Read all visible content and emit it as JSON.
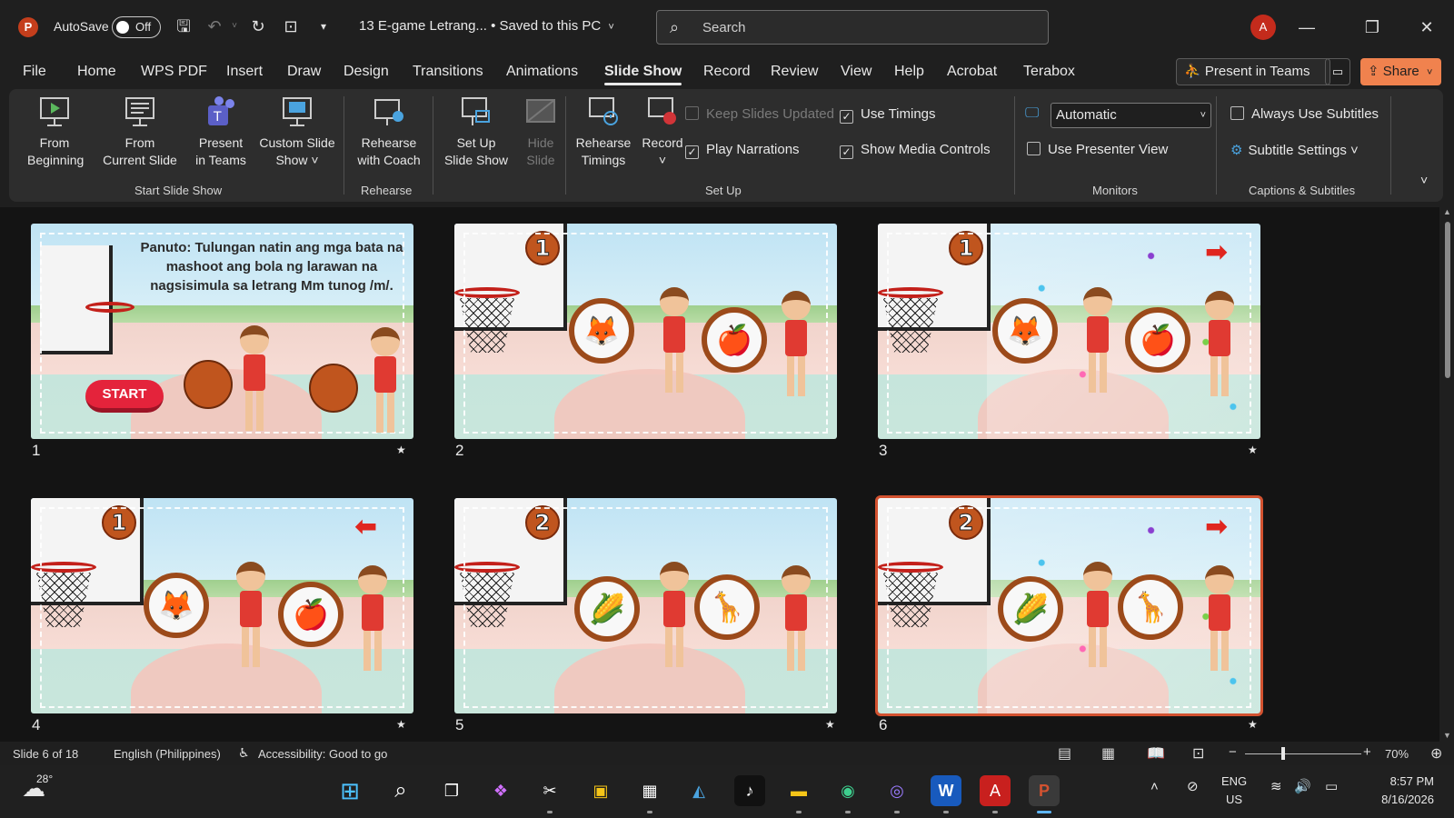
{
  "titlebar": {
    "autosave_label": "AutoSave",
    "autosave_state": "Off",
    "document_title": "13 E-game Letrang...  •  Saved to this PC",
    "search_placeholder": "Search",
    "avatar_initial": "A"
  },
  "menu": {
    "tabs": [
      "File",
      "Home",
      "WPS PDF",
      "Insert",
      "Draw",
      "Design",
      "Transitions",
      "Animations",
      "Slide Show",
      "Record",
      "Review",
      "View",
      "Help",
      "Acrobat",
      "Terabox"
    ],
    "active": "Slide Show",
    "present_in_teams": "Present in Teams",
    "share": "Share"
  },
  "ribbon": {
    "from_beginning": [
      "From",
      "Beginning"
    ],
    "from_current": [
      "From",
      "Current Slide"
    ],
    "present_in_teams": [
      "Present",
      "in Teams"
    ],
    "custom_show": [
      "Custom Slide",
      "Show ˅"
    ],
    "rehearse_coach": [
      "Rehearse",
      "with Coach"
    ],
    "setup_show": [
      "Set Up",
      "Slide Show"
    ],
    "hide_slide": [
      "Hide",
      "Slide"
    ],
    "rehearse_timings": [
      "Rehearse",
      "Timings"
    ],
    "record": [
      "Record",
      "˅"
    ],
    "keep_slides_updated": "Keep Slides Updated",
    "play_narrations": "Play Narrations",
    "use_timings": "Use Timings",
    "show_media_controls": "Show Media Controls",
    "monitor_value": "Automatic",
    "use_presenter_view": "Use Presenter View",
    "always_use_subtitles": "Always Use Subtitles",
    "subtitle_settings": "Subtitle Settings ˅",
    "groups": {
      "start_slide_show": "Start Slide Show",
      "rehearse": "Rehearse",
      "set_up": "Set Up",
      "monitors": "Monitors",
      "captions": "Captions & Subtitles"
    }
  },
  "slide1": {
    "instruction": "Panuto: Tulungan natin ang mga bata na mashoot ang bola ng larawan na nagsisimula sa letrang Mm tunog /m/.",
    "start": "START"
  },
  "slides": {
    "numbers": [
      "1",
      "2",
      "3",
      "4",
      "5",
      "6"
    ],
    "scores": {
      "s2": "1",
      "s3": "1",
      "s4": "1",
      "s5": "2",
      "s6": "2"
    }
  },
  "status": {
    "slide_indicator": "Slide 6 of 18",
    "language": "English (Philippines)",
    "accessibility": "Accessibility: Good to go",
    "zoom": "70%"
  },
  "taskbar": {
    "temperature": "28°",
    "lang_top": "ENG",
    "lang_bottom": "US",
    "time": "8:57 PM",
    "date": "8/16/2026"
  }
}
